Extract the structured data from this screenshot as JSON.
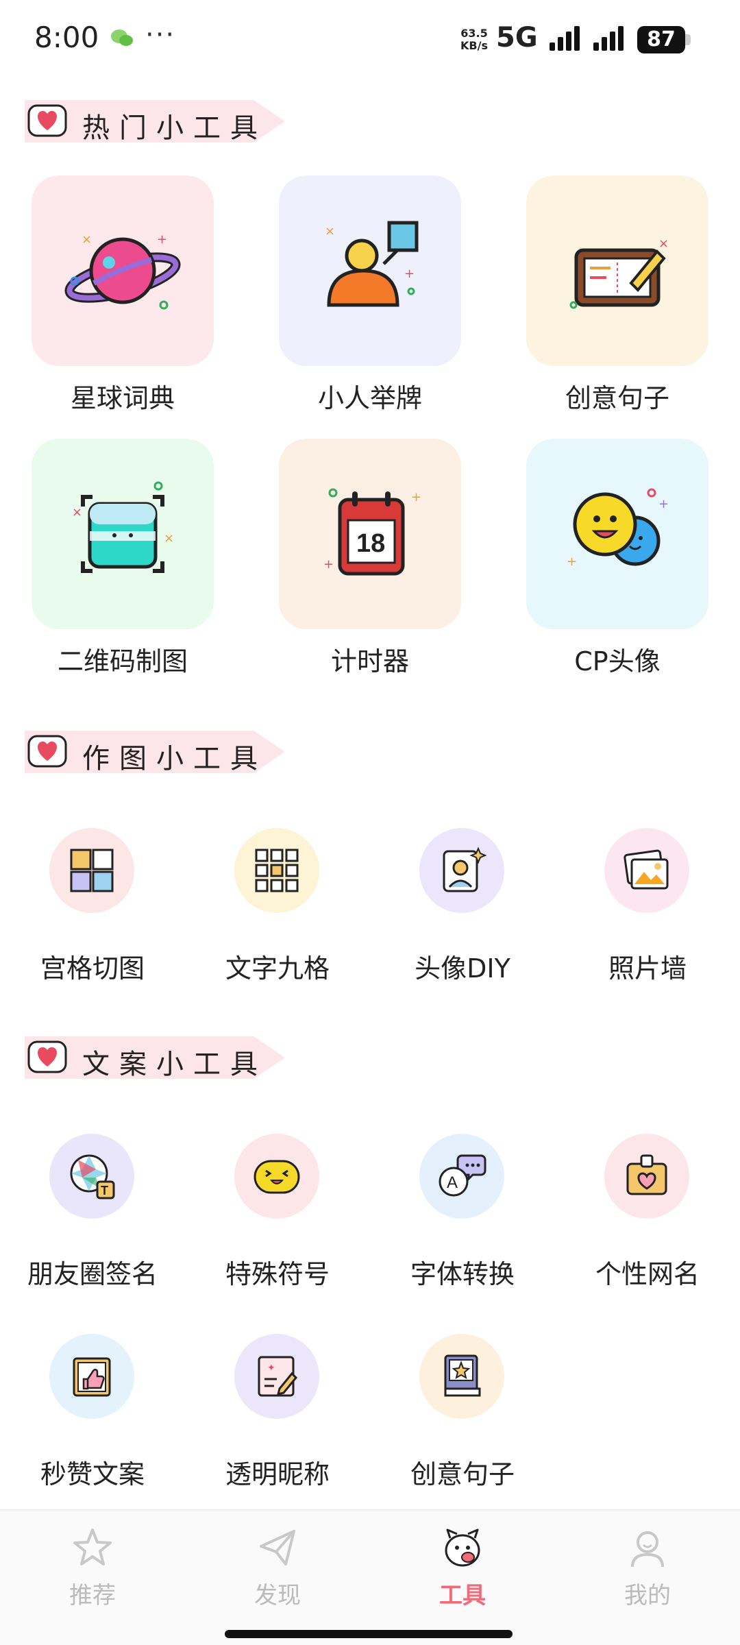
{
  "status_bar": {
    "time": "8:00",
    "dots": "···",
    "speed_value": "63.5",
    "speed_unit": "KB/s",
    "network": "5G",
    "battery": "87"
  },
  "sections": {
    "hot": {
      "title": "热门小工具"
    },
    "draw": {
      "title": "作图小工具"
    },
    "copy": {
      "title": "文案小工具"
    }
  },
  "hot_tools": [
    {
      "label": "星球词典",
      "icon": "planet-icon",
      "bg": "#fde8ec"
    },
    {
      "label": "小人举牌",
      "icon": "sign-person-icon",
      "bg": "#eef1fc"
    },
    {
      "label": "创意句子",
      "icon": "notebook-pen-icon",
      "bg": "#fdf3e1"
    },
    {
      "label": "二维码制图",
      "icon": "qr-scan-icon",
      "bg": "#e8fbec"
    },
    {
      "label": "计时器",
      "icon": "calendar-icon",
      "bg": "#fcefe3"
    },
    {
      "label": "CP头像",
      "icon": "smiley-pair-icon",
      "bg": "#e6f8fb"
    }
  ],
  "draw_tools": [
    {
      "label": "宫格切图",
      "icon": "grid-cut-icon",
      "bg": "#fde6e6"
    },
    {
      "label": "文字九格",
      "icon": "nine-grid-icon",
      "bg": "#fdf4d6"
    },
    {
      "label": "头像DIY",
      "icon": "avatar-diy-icon",
      "bg": "#ebe6fb"
    },
    {
      "label": "照片墙",
      "icon": "photo-wall-icon",
      "bg": "#fce6f0"
    }
  ],
  "copy_tools": [
    {
      "label": "朋友圈签名",
      "icon": "aperture-text-icon",
      "bg": "#e9e6fb"
    },
    {
      "label": "特殊符号",
      "icon": "emoji-face-icon",
      "bg": "#fde6e8"
    },
    {
      "label": "字体转换",
      "icon": "chat-a-icon",
      "bg": "#e4f1fd"
    },
    {
      "label": "个性网名",
      "icon": "heart-card-icon",
      "bg": "#fde6ea"
    },
    {
      "label": "秒赞文案",
      "icon": "thumbs-up-icon",
      "bg": "#e4f2fc"
    },
    {
      "label": "透明昵称",
      "icon": "note-pen-icon",
      "bg": "#ece6fb"
    },
    {
      "label": "创意句子",
      "icon": "star-book-icon",
      "bg": "#fdf0dc"
    }
  ],
  "nav": [
    {
      "label": "推荐",
      "icon": "star-icon",
      "active": false
    },
    {
      "label": "发现",
      "icon": "paper-plane-icon",
      "active": false
    },
    {
      "label": "工具",
      "icon": "mascot-icon",
      "active": true
    },
    {
      "label": "我的",
      "icon": "user-icon",
      "active": false
    }
  ],
  "colors": {
    "accent": "#f06a7a",
    "banner": "#fde6ea",
    "heart": "#e84a5f"
  }
}
